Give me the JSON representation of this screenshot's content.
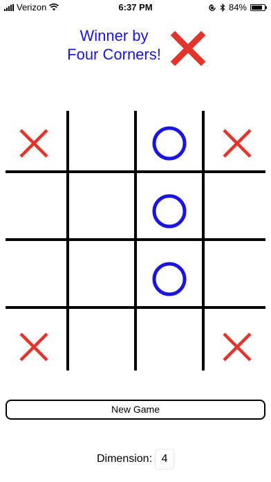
{
  "status_bar": {
    "carrier": "Verizon",
    "time": "6:37 PM",
    "battery": "84%",
    "battery_level": 0.84,
    "icons": [
      "signal-icon",
      "wifi-icon",
      "orientation-lock-icon",
      "bluetooth-icon",
      "battery-icon"
    ]
  },
  "header": {
    "line1": "Winner by",
    "line2": "Four Corners!",
    "winner_icon": "x-mark-icon"
  },
  "board": {
    "dimension": 4,
    "cells": [
      [
        "X",
        "",
        "O",
        "X"
      ],
      [
        "",
        "",
        "O",
        ""
      ],
      [
        "",
        "",
        "O",
        ""
      ],
      [
        "X",
        "",
        "",
        "X"
      ]
    ]
  },
  "buttons": {
    "new_game": "New Game"
  },
  "dimension": {
    "label": "Dimension:",
    "value": "4"
  },
  "colors": {
    "x_mark": "#e2342a",
    "o_mark": "#1a14e0",
    "header_text": "#1a14e0",
    "grid_line": "#000000"
  }
}
